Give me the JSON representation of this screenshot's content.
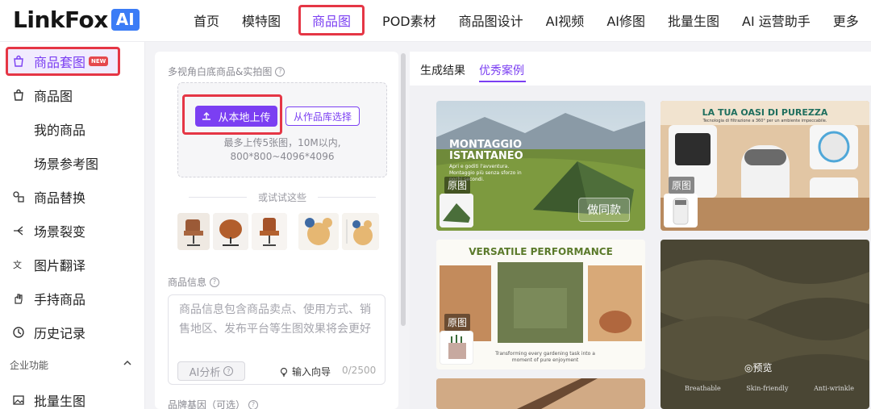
{
  "logo": {
    "text": "LinkFox",
    "badge": "AI"
  },
  "nav": {
    "items": [
      {
        "label": "首页"
      },
      {
        "label": "模特图"
      },
      {
        "label": "商品图",
        "active": true
      },
      {
        "label": "POD素材"
      },
      {
        "label": "商品图设计"
      },
      {
        "label": "AI视频"
      },
      {
        "label": "AI修图"
      },
      {
        "label": "批量生图"
      },
      {
        "label": "AI 运营助手"
      },
      {
        "label": "更多"
      }
    ]
  },
  "sidebar": {
    "items": [
      {
        "label": "商品套图",
        "badge": "NEW",
        "icon": "bag-icon",
        "active": true
      },
      {
        "label": "商品图",
        "icon": "bag-icon"
      },
      {
        "label": "我的商品"
      },
      {
        "label": "场景参考图"
      },
      {
        "label": "商品替换",
        "icon": "swap-icon"
      },
      {
        "label": "场景裂变",
        "icon": "split-icon"
      },
      {
        "label": "图片翻译",
        "icon": "translate-icon"
      },
      {
        "label": "手持商品",
        "icon": "hand-icon"
      },
      {
        "label": "历史记录",
        "icon": "history-icon"
      }
    ],
    "group_label": "企业功能",
    "group_items": [
      {
        "label": "批量生图",
        "icon": "image-icon"
      }
    ]
  },
  "form": {
    "upload_section_label": "多视角白底商品&实拍图",
    "upload_button": "从本地上传",
    "library_button": "从作品库选择",
    "upload_hint_line1": "最多上传5张图，10M以内,",
    "upload_hint_line2": "800*800~4096*4096",
    "try_label": "或试试这些",
    "info_label": "商品信息",
    "info_placeholder": "商品信息包含商品卖点、使用方式、销售地区、发布平台等生图效果将会更好",
    "ai_button": "AI分析",
    "guide_label": "输入向导",
    "char_count": "0/2500",
    "brand_label": "品牌基因（可选）"
  },
  "results": {
    "tabs": [
      {
        "label": "生成结果"
      },
      {
        "label": "优秀案例",
        "active": true
      }
    ],
    "cards": [
      {
        "headline": "MONTAGGIO ISTANTANEO",
        "subtext": "Apri e goditi l'avventura. Montaggio più senza sforzo in pochi secondi.",
        "tag": "原图",
        "action": "做同款"
      },
      {
        "headline": "LA TUA OASI DI PUREZZA",
        "subtext": "Tecnologia di filtrazione a 360° per un ambiente impeccabile.",
        "tag": "原图"
      },
      {
        "headline": "VERSATILE PERFORMANCE",
        "subtext": "Transforming every gardening task into a moment of pure enjoyment",
        "tag": "原图"
      },
      {
        "preview": "预览",
        "features": [
          "Breathable",
          "Skin-friendly",
          "Anti-wrinkle"
        ]
      }
    ]
  },
  "colors": {
    "accent": "#7b3ff2",
    "highlight": "#e53645",
    "logo_badge": "#3b7cf6"
  }
}
